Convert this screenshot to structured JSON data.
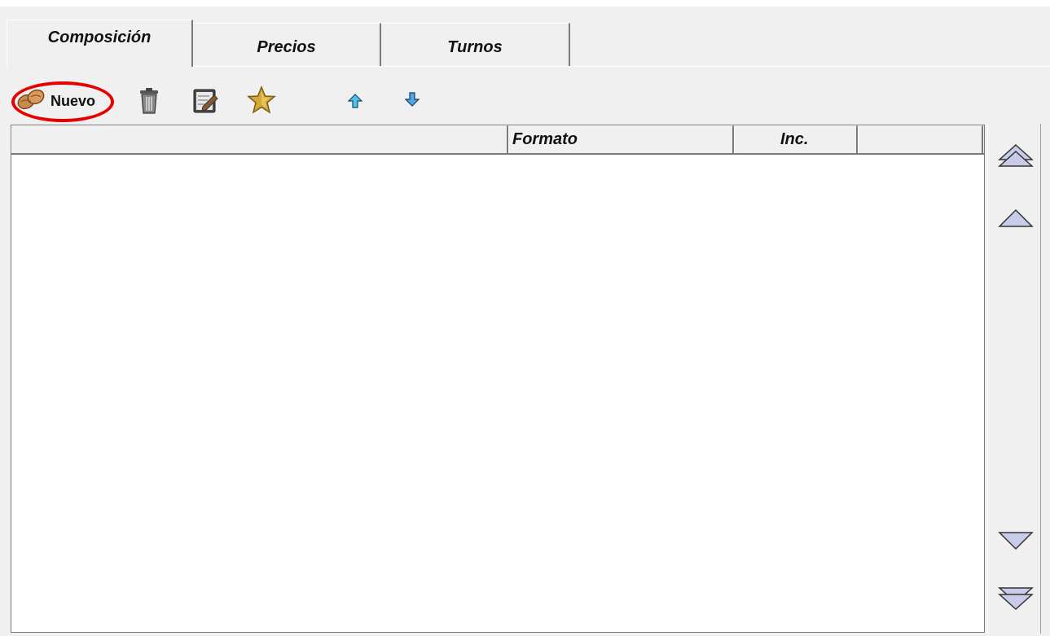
{
  "tabs": [
    {
      "label": "Composición",
      "active": true
    },
    {
      "label": "Precios",
      "active": false
    },
    {
      "label": "Turnos",
      "active": false
    }
  ],
  "toolbar": {
    "new_label": "Nuevo",
    "new_icon": "peanut-icon",
    "delete_icon": "trash-icon",
    "edit_icon": "edit-document-icon",
    "favorite_icon": "star-icon",
    "move_up_icon": "arrow-up-icon",
    "move_down_icon": "arrow-down-icon",
    "highlight_color": "#e60000"
  },
  "grid": {
    "columns": [
      "",
      "Formato",
      "Inc.",
      ""
    ],
    "rows": []
  },
  "scroller": {
    "buttons": [
      "scroll-top-icon",
      "scroll-up-icon",
      "scroll-down-icon",
      "scroll-bottom-icon"
    ],
    "arrow_fill": "#c8cce8"
  }
}
